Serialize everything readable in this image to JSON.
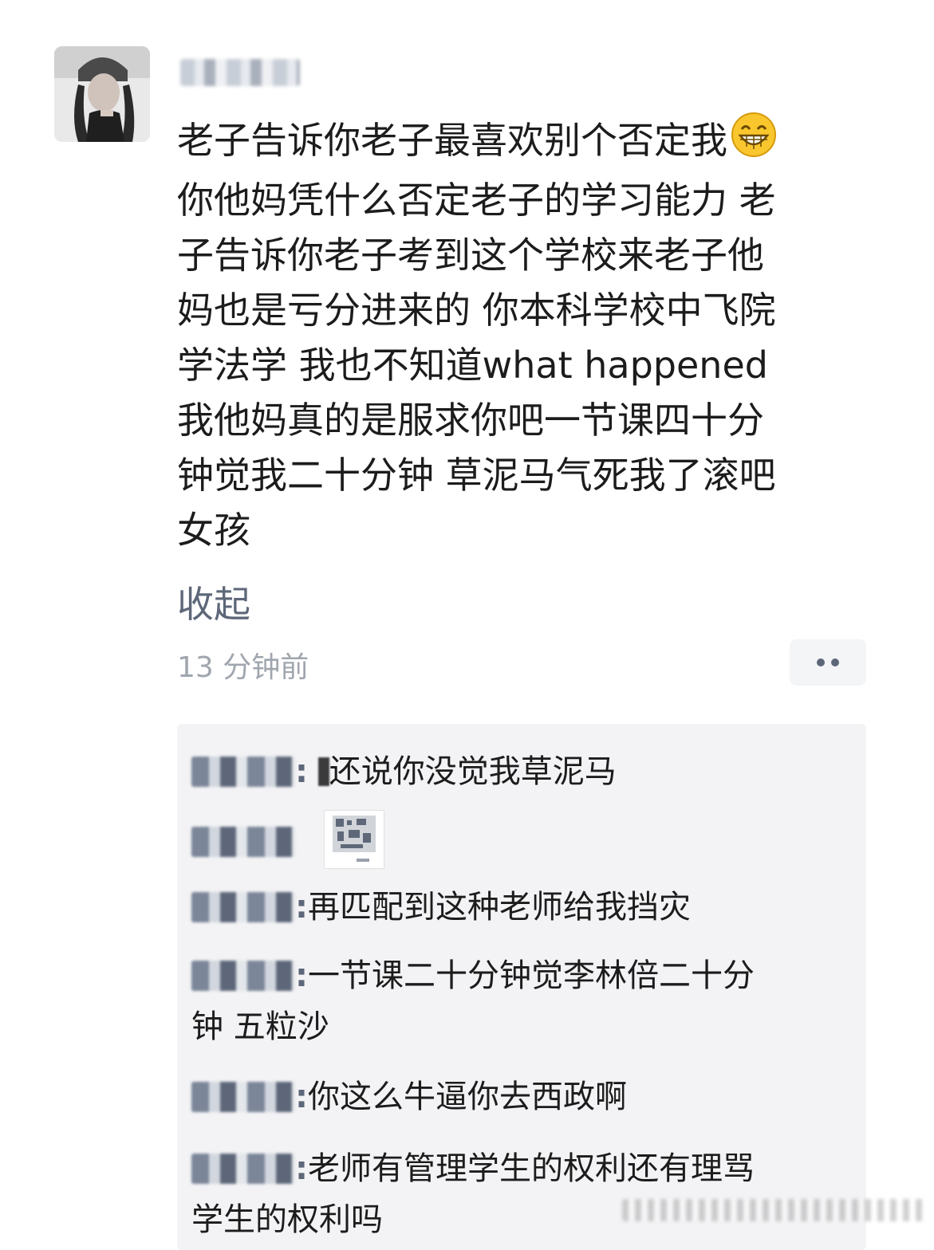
{
  "post": {
    "lines": [
      "老子告诉你老子最喜欢别个否定我",
      "你他妈凭什么否定老子的学习能力 老",
      "子告诉你老子考到这个学校来老子他",
      "妈也是亏分进来的 你本科学校中飞院",
      "学法学 我也不知道what happened",
      "我他妈真的是服求你吧一节课四十分",
      "钟觉我二十分钟 草泥马气死我了滚吧",
      "女孩"
    ],
    "emoji": "grinning-face-icon",
    "collapse_label": "收起",
    "time": "13 分钟前"
  },
  "comments": [
    {
      "lines": [
        "还说你没觉我草泥马"
      ],
      "has_mosaic": true
    },
    {
      "lines": [],
      "has_image": true
    },
    {
      "lines": [
        "再匹配到这种老师给我挡灾"
      ]
    },
    {
      "lines": [
        "一节课二十分钟觉李林倍二十分",
        "钟    五粒沙"
      ]
    },
    {
      "lines": [
        "你这么牛逼你去西政啊"
      ]
    },
    {
      "lines": [
        "老师有管理学生的权利还有理骂",
        "学生的权利吗"
      ]
    }
  ],
  "colors": {
    "text": "#1c1c1c",
    "name": "#5d6779",
    "meta": "#a0a6ae",
    "comment_bg": "#f3f3f5"
  }
}
